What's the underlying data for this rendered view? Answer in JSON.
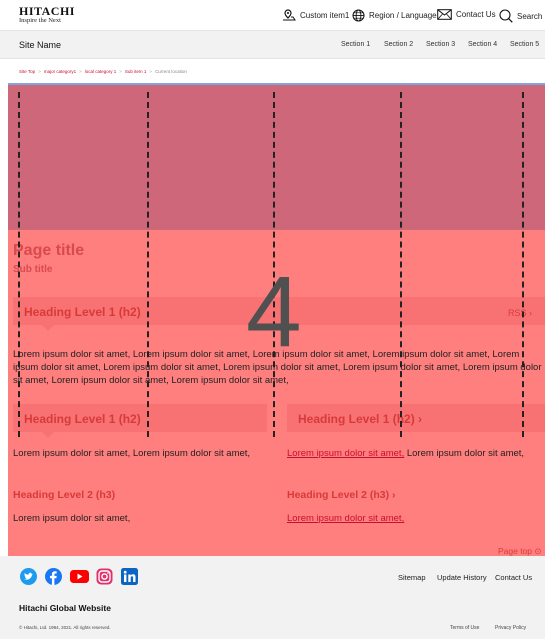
{
  "header": {
    "brand": "HITACHI",
    "tagline": "Inspire the Next",
    "utility": [
      "Custom item1",
      "Region / Language",
      "Contact Us",
      "Search"
    ],
    "site_name": "Site Name",
    "sections": [
      "Section 1",
      "Section 2",
      "Section 3",
      "Section 4",
      "Section 5"
    ]
  },
  "breadcrumb": [
    "Site Top",
    "major category1",
    "local category 1",
    "Sub item 1",
    "Current location"
  ],
  "page": {
    "title": "Page title",
    "subtitle": "Sub title",
    "h2_full": "Heading Level 1 (h2)",
    "rss": "RSS",
    "paragraph": "Lorem ipsum dolor sit amet, Lorem ipsum dolor sit amet, Lorem ipsum dolor sit amet, Lorem ipsum dolor sit amet, Lorem ipsum dolor sit amet, Lorem ipsum dolor sit amet, Lorem ipsum dolor sit amet, Lorem ipsum dolor sit amet, Lorem ipsum dolor sit amet, Lorem ipsum dolor sit amet, Lorem ipsum dolor sit amet,",
    "left": {
      "h2": "Heading Level 1 (h2)",
      "text": "Lorem ipsum dolor sit amet, Lorem ipsum dolor sit amet,",
      "h3": "Heading Level 2 (h3)",
      "text2": "Lorem ipsum dolor sit amet,"
    },
    "right": {
      "h2": "Heading Level 1 (h2)",
      "link": "Lorem ipsum dolor sit amet,",
      "text_rest": " Lorem ipsum dolor sit amet,",
      "h3": "Heading Level 2 (h3)",
      "link2": "Lorem ipsum dolor sit amet,"
    },
    "page_top": "Page top",
    "overlay_number": "4"
  },
  "footer": {
    "social_icons": [
      "twitter-icon",
      "facebook-icon",
      "youtube-icon",
      "instagram-icon",
      "linkedin-icon"
    ],
    "links": [
      "Sitemap",
      "Update History",
      "Contact Us"
    ],
    "site": "Hitachi Global Website",
    "copyright": "© Hitachi, Ltd. 1994, 2021. All rights reserved.",
    "legal": [
      "Terms of Use",
      "Privacy Policy"
    ]
  }
}
